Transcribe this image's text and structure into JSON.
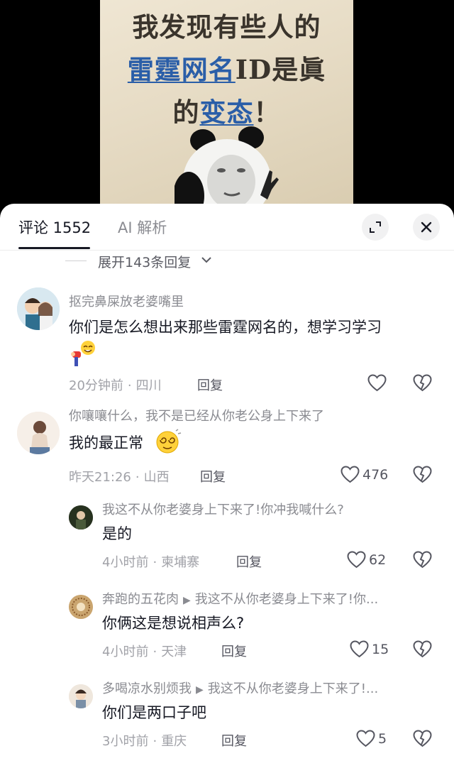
{
  "video": {
    "poster_line1": "我发现有些人的",
    "poster_line2_a": "雷霆网名",
    "poster_line2_b": "ID是眞",
    "poster_line3_a": "的",
    "poster_line3_b": "变态",
    "poster_line3_c": "！"
  },
  "tabs": {
    "comments_label": "评论 1552",
    "ai_label": "AI 解析"
  },
  "expand_replies": "展开143条回复",
  "comments": [
    {
      "username": "抠完鼻屎放老婆嘴里",
      "text": "你们是怎么想出来那些雷霆网名的，想学习学习",
      "time": "20分钟前",
      "location": "四川",
      "reply_label": "回复",
      "likes": ""
    },
    {
      "username": "你嚷嚷什么，我不是已经从你老公身上下来了",
      "text": "我的最正常",
      "time": "昨天21:26",
      "location": "山西",
      "reply_label": "回复",
      "likes": "476"
    }
  ],
  "replies": [
    {
      "username": "我这不从你老婆身上下来了!你冲我喊什么?",
      "reply_to": "",
      "text": "是的",
      "time": "4小时前",
      "location": "柬埔寨",
      "reply_label": "回复",
      "likes": "62"
    },
    {
      "username": "奔跑的五花肉",
      "reply_to": "我这不从你老婆身上下来了!你...",
      "text": "你俩这是想说相声么?",
      "time": "4小时前",
      "location": "天津",
      "reply_label": "回复",
      "likes": "15"
    },
    {
      "username": "多喝凉水别烦我",
      "reply_to": "我这不从你老婆身上下来了!...",
      "text": "你们是两口子吧",
      "time": "3小时前",
      "location": "重庆",
      "reply_label": "回复",
      "likes": "5"
    }
  ],
  "colors": {
    "accent_blue": "#2a5ea8",
    "text_primary": "#161823",
    "text_secondary": "#8a8b91"
  }
}
